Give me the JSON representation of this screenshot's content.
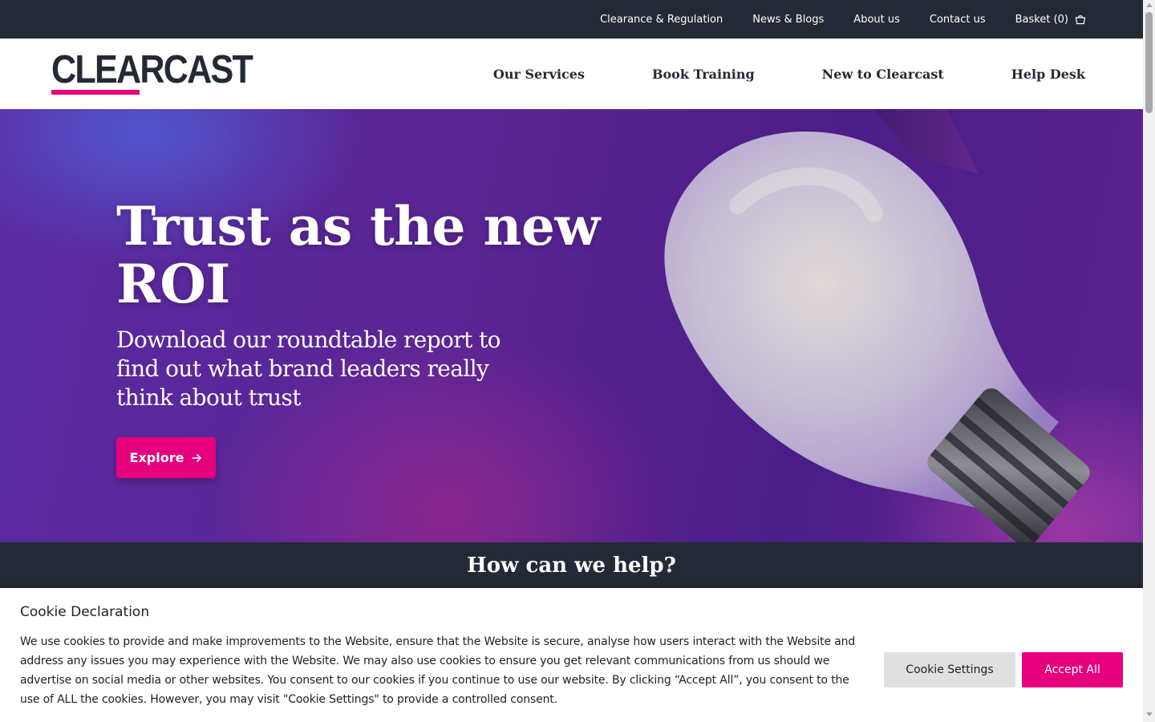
{
  "utility_nav": {
    "items": [
      "Clearance & Regulation",
      "News & Blogs",
      "About us",
      "Contact us"
    ],
    "basket_label": "Basket (0)",
    "basket_icon": "basket-icon"
  },
  "brand": {
    "logo_text": "CLEARCAST",
    "accent_color": "#e6007e",
    "dark_color": "#242a35"
  },
  "main_nav": {
    "items": [
      "Our Services",
      "Book Training",
      "New to Clearcast",
      "Help Desk"
    ]
  },
  "hero": {
    "title": "Trust as the new ROI",
    "subtitle": "Download our roundtable report to find out what brand leaders really think about trust",
    "cta_label": "Explore",
    "cta_icon": "arrow-right-icon"
  },
  "help": {
    "title": "How can we help?"
  },
  "cookie_banner": {
    "title": "Cookie Declaration",
    "text": "We use cookies to provide and make improvements to the Website, ensure that the Website is secure, analyse how users interact with the Website and address any issues you may experience with the Website. We may also use cookies to ensure you get relevant communications from us should we advertise on social media or other websites. You consent to our cookies if you continue to use our website. By clicking “Accept All”, you consent to the use of ALL the cookies. However, you may visit \"Cookie Settings\" to provide a controlled consent.",
    "settings_label": "Cookie Settings",
    "accept_label": "Accept All"
  }
}
